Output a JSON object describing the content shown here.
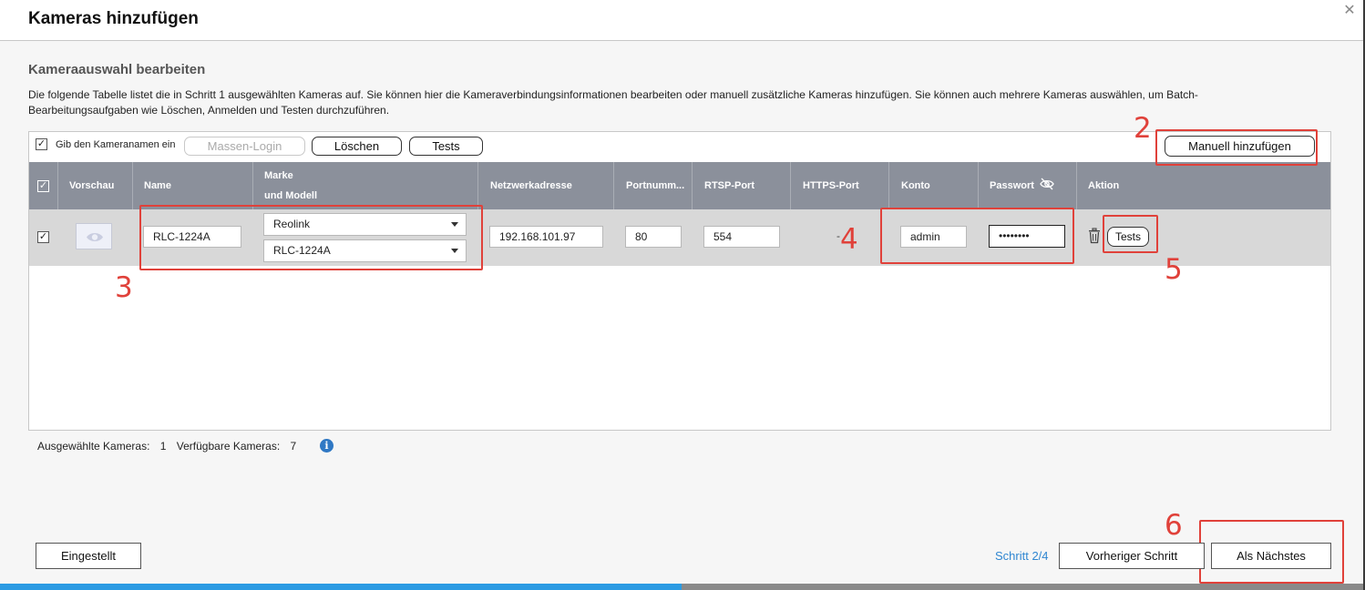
{
  "dialog": {
    "title": "Kameras hinzufügen",
    "close_glyph": "✕"
  },
  "section": {
    "title": "Kameraauswahl bearbeiten",
    "description": "Die folgende Tabelle listet die in Schritt 1 ausgewählten Kameras auf. Sie können hier die Kameraverbindungsinformationen bearbeiten oder manuell zusätzliche Kameras hinzufügen. Sie können auch mehrere Kameras auswählen, um Batch-Bearbeitungsaufgaben wie Löschen, Anmelden und Testen durchzuführen."
  },
  "toolbar": {
    "checkbox_label": "Gib den Kameranamen ein",
    "checkbox_checked": true,
    "massen_login": "Massen-Login",
    "loeschen": "Löschen",
    "tests": "Tests",
    "manual_add": "Manuell hinzufügen"
  },
  "table": {
    "columns": {
      "vorschau": "Vorschau",
      "name": "Name",
      "marke_line1": "Marke",
      "marke_line2": "und Modell",
      "netzwerk": "Netzwerkadresse",
      "port": "Portnumm...",
      "rtsp": "RTSP-Port",
      "https": "HTTPS-Port",
      "konto": "Konto",
      "passwort": "Passwort",
      "aktion": "Aktion"
    },
    "rows": [
      {
        "checked": true,
        "name": "RLC-1224A",
        "brand": "Reolink",
        "model": "RLC-1224A",
        "network": "192.168.101.97",
        "port": "80",
        "rtsp": "554",
        "https": "-",
        "account": "admin",
        "password": "••••••••",
        "action_tests": "Tests"
      }
    ]
  },
  "annotations": {
    "m2": "2",
    "m3": "3",
    "m4": "4",
    "m5": "5",
    "m6": "6",
    "color": "#e0413a"
  },
  "footer": {
    "selected_label": "Ausgewählte Kameras:",
    "selected_count": "1",
    "available_label": "Verfügbare Kameras:",
    "available_count": "7",
    "info_glyph": "i",
    "eingestellt": "Eingestellt",
    "step": "Schritt 2/4",
    "prev": "Vorheriger Schritt",
    "next": "Als Nächstes",
    "progress_fraction": 0.5
  },
  "colors": {
    "header_bg": "#8b909b",
    "row_bg": "#d8d8d8",
    "accent_blue": "#2b9be3",
    "link_blue": "#2f86d1"
  }
}
